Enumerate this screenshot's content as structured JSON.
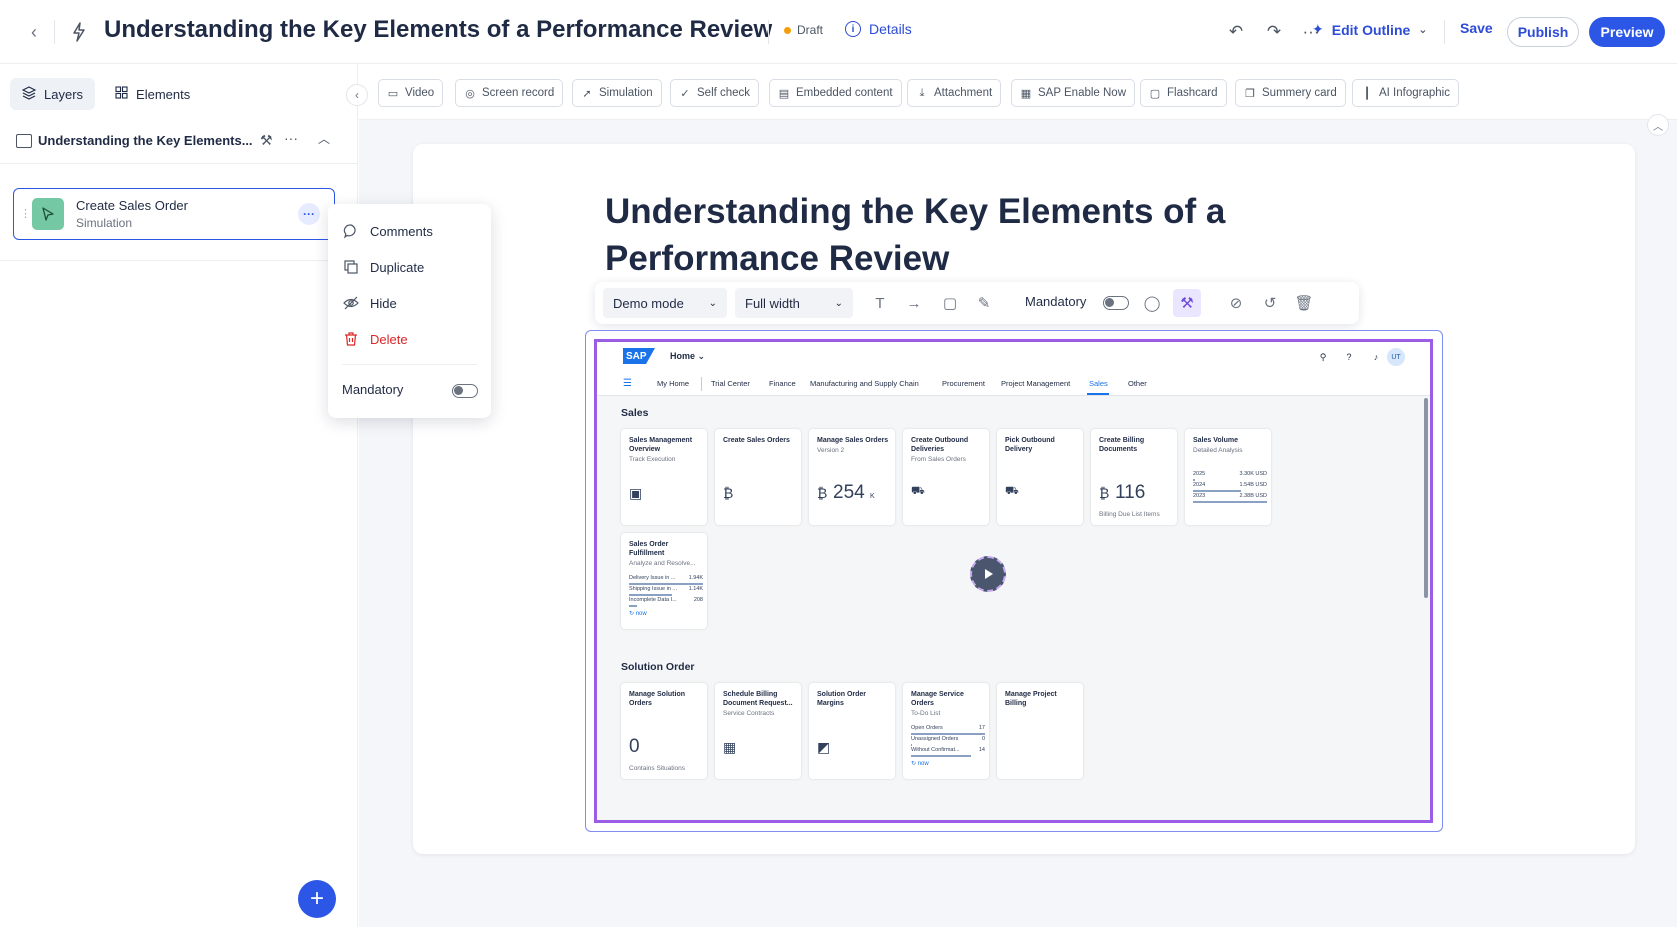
{
  "header": {
    "title": "Understanding the Key Elements of a Performance Review",
    "status": "Draft",
    "details_label": "Details",
    "edit_outline_label": "Edit Outline",
    "save_label": "Save",
    "publish_label": "Publish",
    "preview_label": "Preview",
    "more_glyph": "···"
  },
  "left_panel": {
    "tabs": [
      {
        "label": "Layers"
      },
      {
        "label": "Elements"
      }
    ],
    "outline_title": "Understanding the Key Elements...",
    "step": {
      "title": "Create Sales Order",
      "subtitle": "Simulation"
    }
  },
  "context_menu": {
    "items": [
      {
        "label": "Comments",
        "icon": "comment-icon"
      },
      {
        "label": "Duplicate",
        "icon": "duplicate-icon"
      },
      {
        "label": "Hide",
        "icon": "eye-off-icon"
      },
      {
        "label": "Delete",
        "icon": "trash-icon"
      }
    ],
    "mandatory_label": "Mandatory"
  },
  "toolbar": {
    "buttons": [
      {
        "label": "Video",
        "icon": "video-icon"
      },
      {
        "label": "Screen record",
        "icon": "screen-record-icon"
      },
      {
        "label": "Simulation",
        "icon": "cursor-icon"
      },
      {
        "label": "Self check",
        "icon": "check-circle-icon"
      },
      {
        "label": "Embedded content",
        "icon": "document-icon"
      },
      {
        "label": "Attachment",
        "icon": "download-icon"
      },
      {
        "label": "SAP Enable Now",
        "icon": "layout-icon"
      },
      {
        "label": "Flashcard",
        "icon": "flashcard-icon"
      },
      {
        "label": "Summery card",
        "icon": "copy-icon"
      },
      {
        "label": "AI Infographic",
        "icon": "chart-icon"
      }
    ]
  },
  "canvas": {
    "title": "Understanding the Key Elements of a Performance Review",
    "media_bar": {
      "mode_value": "Demo mode",
      "width_value": "Full width",
      "mandatory_label": "Mandatory"
    }
  },
  "sap": {
    "logo": "SAP",
    "home_label": "Home ⌄",
    "avatar": "UT",
    "nav": [
      "My Home",
      "Trial Center",
      "Finance",
      "Manufacturing and Supply Chain",
      "Procurement",
      "Project Management",
      "Sales",
      "Other"
    ],
    "sales_section": "Sales",
    "solution_section": "Solution Order",
    "tiles": {
      "t1": {
        "title": "Sales Management Overview",
        "sub": "Track Execution"
      },
      "t2": {
        "title": "Create Sales Orders"
      },
      "t3": {
        "title": "Manage Sales Orders",
        "sub": "Version 2",
        "num": "254",
        "unit": "K"
      },
      "t4": {
        "title": "Create Outbound Deliveries",
        "sub": "From Sales Orders"
      },
      "t5": {
        "title": "Pick Outbound Delivery"
      },
      "t6": {
        "title": "Create Billing Documents",
        "num": "116",
        "foot": "Billing Due List Items"
      },
      "t7": {
        "title": "Sales Volume",
        "sub": "Detailed Analysis",
        "rows": [
          {
            "k": "2025",
            "v": "3.30K USD"
          },
          {
            "k": "2024",
            "v": "1.54B USD"
          },
          {
            "k": "2023",
            "v": "2.38B USD"
          }
        ]
      },
      "t8": {
        "title": "Sales Order Fulfillment",
        "sub": "Analyze and Resolve...",
        "rows": [
          {
            "k": "Delivery Issue in ...",
            "v": "1.94K"
          },
          {
            "k": "Shipping Issue in ...",
            "v": "1.14K"
          },
          {
            "k": "Incomplete Data I...",
            "v": "208"
          }
        ],
        "now": "↻ now"
      },
      "s1": {
        "title": "Manage Solution Orders",
        "num": "0",
        "foot": "Contains Situations"
      },
      "s2": {
        "title": "Schedule Billing Document Request...",
        "sub": "Service Contracts"
      },
      "s3": {
        "title": "Solution Order Margins"
      },
      "s4": {
        "title": "Manage Service Orders",
        "sub": "To-Do List",
        "rows": [
          {
            "k": "Open Orders",
            "v": "17"
          },
          {
            "k": "Unassigned Orders",
            "v": "0"
          },
          {
            "k": "Without Confirmat...",
            "v": "14"
          }
        ],
        "now": "↻ now"
      },
      "s5": {
        "title": "Manage Project Billing"
      }
    }
  }
}
